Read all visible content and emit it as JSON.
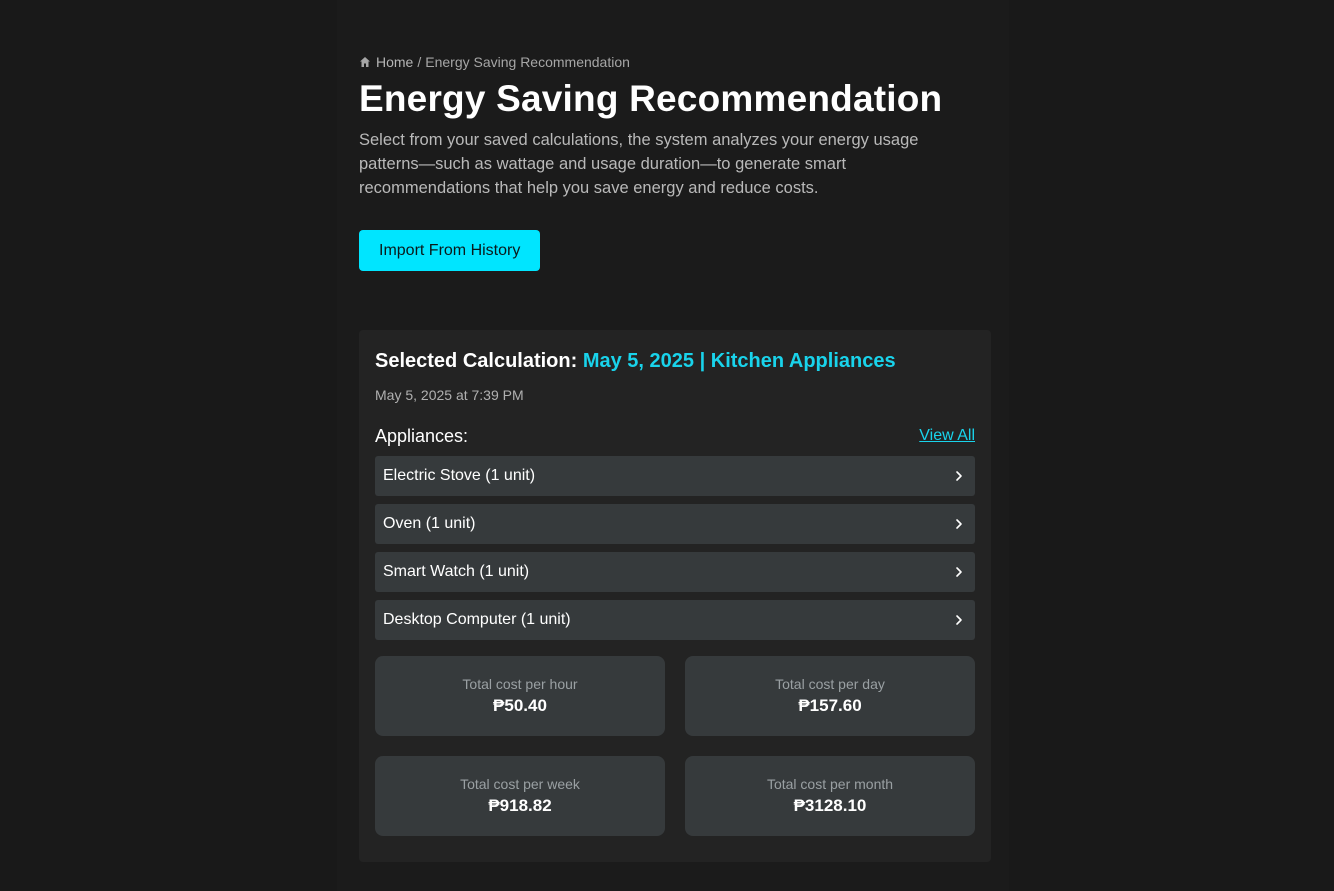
{
  "breadcrumb": {
    "home_label": "Home",
    "separator": "/",
    "current_label": "Energy Saving Recommendation"
  },
  "header": {
    "title": "Energy Saving Recommendation",
    "description": "Select from your saved calculations, the system analyzes your energy usage patterns—such as wattage and usage duration—to generate smart recommendations that help you save energy and reduce costs."
  },
  "import_button_label": "Import From History",
  "selected": {
    "title_prefix": "Selected Calculation:",
    "title_value": "May 5, 2025 | Kitchen Appliances",
    "timestamp": "May 5, 2025 at 7:39 PM",
    "appliances_label": "Appliances:",
    "view_all_label": "View All",
    "appliances": [
      {
        "label": "Electric Stove (1 unit)"
      },
      {
        "label": "Oven (1 unit)"
      },
      {
        "label": "Smart Watch (1 unit)"
      },
      {
        "label": "Desktop Computer (1 unit)"
      }
    ],
    "stats": [
      {
        "label": "Total cost per hour",
        "value": "₱50.40"
      },
      {
        "label": "Total cost per day",
        "value": "₱157.60"
      },
      {
        "label": "Total cost per week",
        "value": "₱918.82"
      },
      {
        "label": "Total cost per month",
        "value": "₱3128.10"
      }
    ]
  },
  "colors": {
    "background": "#191919",
    "accent": "#00e5ff",
    "accent_text": "#19d3eb",
    "card": "#232323",
    "row": "#363a3c"
  },
  "icons": {
    "home": "home-icon",
    "chevron": "chevron-right-icon"
  }
}
